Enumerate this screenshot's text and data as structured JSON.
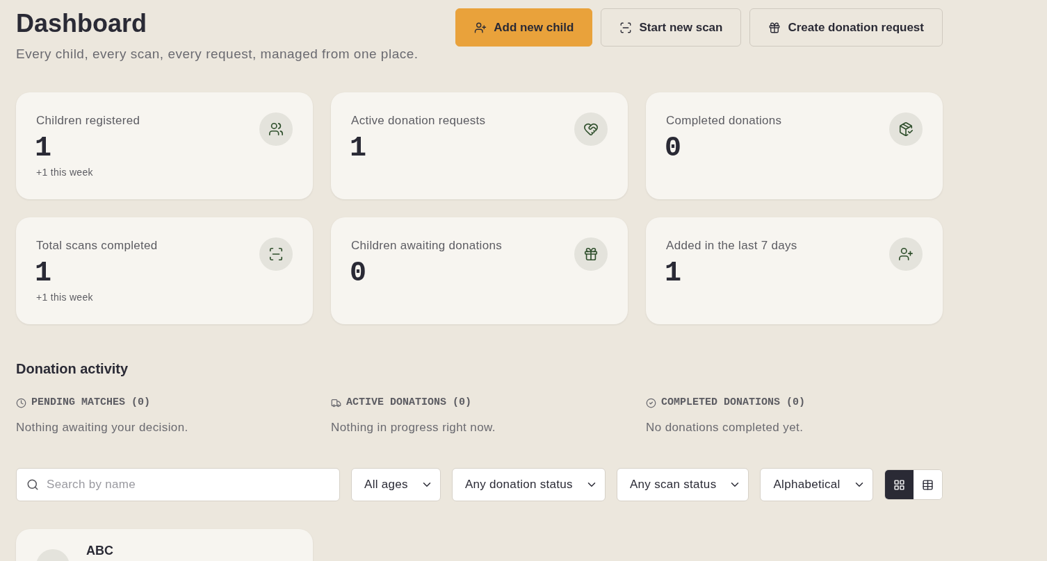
{
  "header": {
    "title": "Dashboard",
    "subtitle": "Every child, every scan, every request, managed from one place."
  },
  "actions": [
    {
      "label": "Add new child",
      "kind": "primary"
    },
    {
      "label": "Start new scan",
      "kind": "secondary"
    },
    {
      "label": "Create donation request",
      "kind": "secondary"
    }
  ],
  "stats": [
    {
      "label": "Children registered",
      "value": "1",
      "note": "+1 this week"
    },
    {
      "label": "Active donation requests",
      "value": "1"
    },
    {
      "label": "Completed donations",
      "value": "0"
    },
    {
      "label": "Total scans completed",
      "value": "1",
      "note": "+1 this week"
    },
    {
      "label": "Children awaiting donations",
      "value": "0"
    },
    {
      "label": "Added in the last 7 days",
      "value": "1"
    }
  ],
  "activity": {
    "title": "Donation activity",
    "columns": [
      {
        "heading": "PENDING MATCHES (0)",
        "text": "Nothing awaiting your decision."
      },
      {
        "heading": "ACTIVE DONATIONS (0)",
        "text": "Nothing in progress right now."
      },
      {
        "heading": "COMPLETED DONATIONS (0)",
        "text": "No donations completed yet."
      }
    ]
  },
  "filters": {
    "search": {
      "placeholder": "Search by name"
    },
    "selects": [
      "All ages",
      "Any donation status",
      "Any scan status",
      "Alphabetical"
    ],
    "view_toggle": [
      {
        "selected": true
      },
      {
        "selected": false
      }
    ]
  },
  "children": [
    {
      "name": "ABC"
    }
  ]
}
